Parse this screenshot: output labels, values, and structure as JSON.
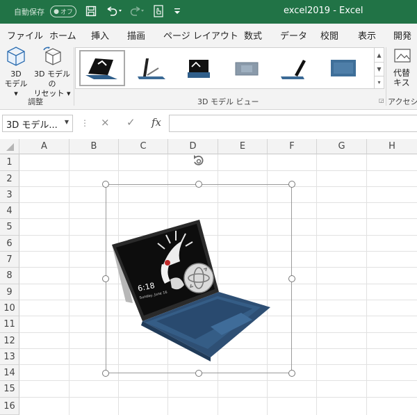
{
  "titlebar": {
    "autosave_label": "自動保存",
    "autosave_state": "オフ",
    "document_title": "excel2019  -  Excel",
    "bg_color": "#217346"
  },
  "tabs": [
    "ファイル",
    "ホーム",
    "挿入",
    "描画",
    "ページ レイアウト",
    "数式",
    "データ",
    "校閲",
    "表示",
    "開発"
  ],
  "ribbon": {
    "model_button": [
      "3D",
      "モデル ▾"
    ],
    "reset_button": [
      "3D モデルの",
      "リセット ▾"
    ],
    "adjust_group": "調整",
    "gallery_group": "3D モデル ビュー",
    "alt_text_button": [
      "代替",
      "キス"
    ],
    "access_group": "アクセシビ"
  },
  "formula_bar": {
    "name_box_value": "3D モデル...",
    "cancel_icon": "×",
    "enter_icon": "✓",
    "fx_icon": "fx",
    "formula_value": ""
  },
  "columns": [
    "A",
    "B",
    "C",
    "D",
    "E",
    "F",
    "G",
    "H"
  ],
  "rows": [
    "1",
    "2",
    "3",
    "4",
    "5",
    "6",
    "7",
    "8",
    "9",
    "10",
    "11",
    "12",
    "13",
    "14",
    "15",
    "16"
  ],
  "laptop_screen": {
    "time": "6:18",
    "date": "Sunday, June 16"
  },
  "icons": [
    "save-icon",
    "undo-icon",
    "redo-icon",
    "touch-mode-icon",
    "customize-qat-icon",
    "3d-model-icon",
    "reset-3d-icon",
    "rotate-handle-icon",
    "rotate-3d-control-icon",
    "alt-text-icon",
    "dialog-launcher-icon"
  ]
}
